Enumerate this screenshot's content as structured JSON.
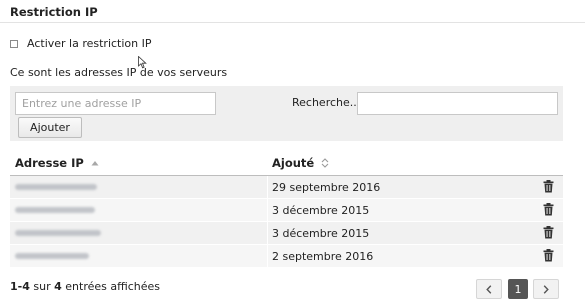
{
  "section": {
    "title": "Restriction IP"
  },
  "restriction": {
    "checkbox_label": "Activer la restriction IP",
    "checked": false
  },
  "description": "Ce sont les adresses IP de vos serveurs",
  "toolbar": {
    "ip_placeholder": "Entrez une adresse IP",
    "ip_value": "",
    "add_label": "Ajouter",
    "search_label": "Recherche...",
    "search_value": ""
  },
  "table": {
    "columns": [
      {
        "label": "Adresse IP",
        "sort": "ascending"
      },
      {
        "label": "Ajouté",
        "sort": "none"
      }
    ],
    "rows": [
      {
        "ip": "",
        "added": "29 septembre 2016"
      },
      {
        "ip": "",
        "added": "3 décembre 2015"
      },
      {
        "ip": "",
        "added": "3 décembre 2015"
      },
      {
        "ip": "",
        "added": "2 septembre 2016"
      }
    ]
  },
  "footer": {
    "range": "1-4",
    "sur": "sur",
    "total": "4",
    "suffix": "entrées affichées"
  },
  "pagination": {
    "prev_icon": "chevron-left-icon",
    "current_page": "1",
    "next_icon": "chevron-right-icon"
  },
  "colors": {
    "row_odd": "#f1f1f1",
    "row_even": "#f6f6f6",
    "toolbar_bg": "#efefef",
    "pager_active": "#555555"
  }
}
